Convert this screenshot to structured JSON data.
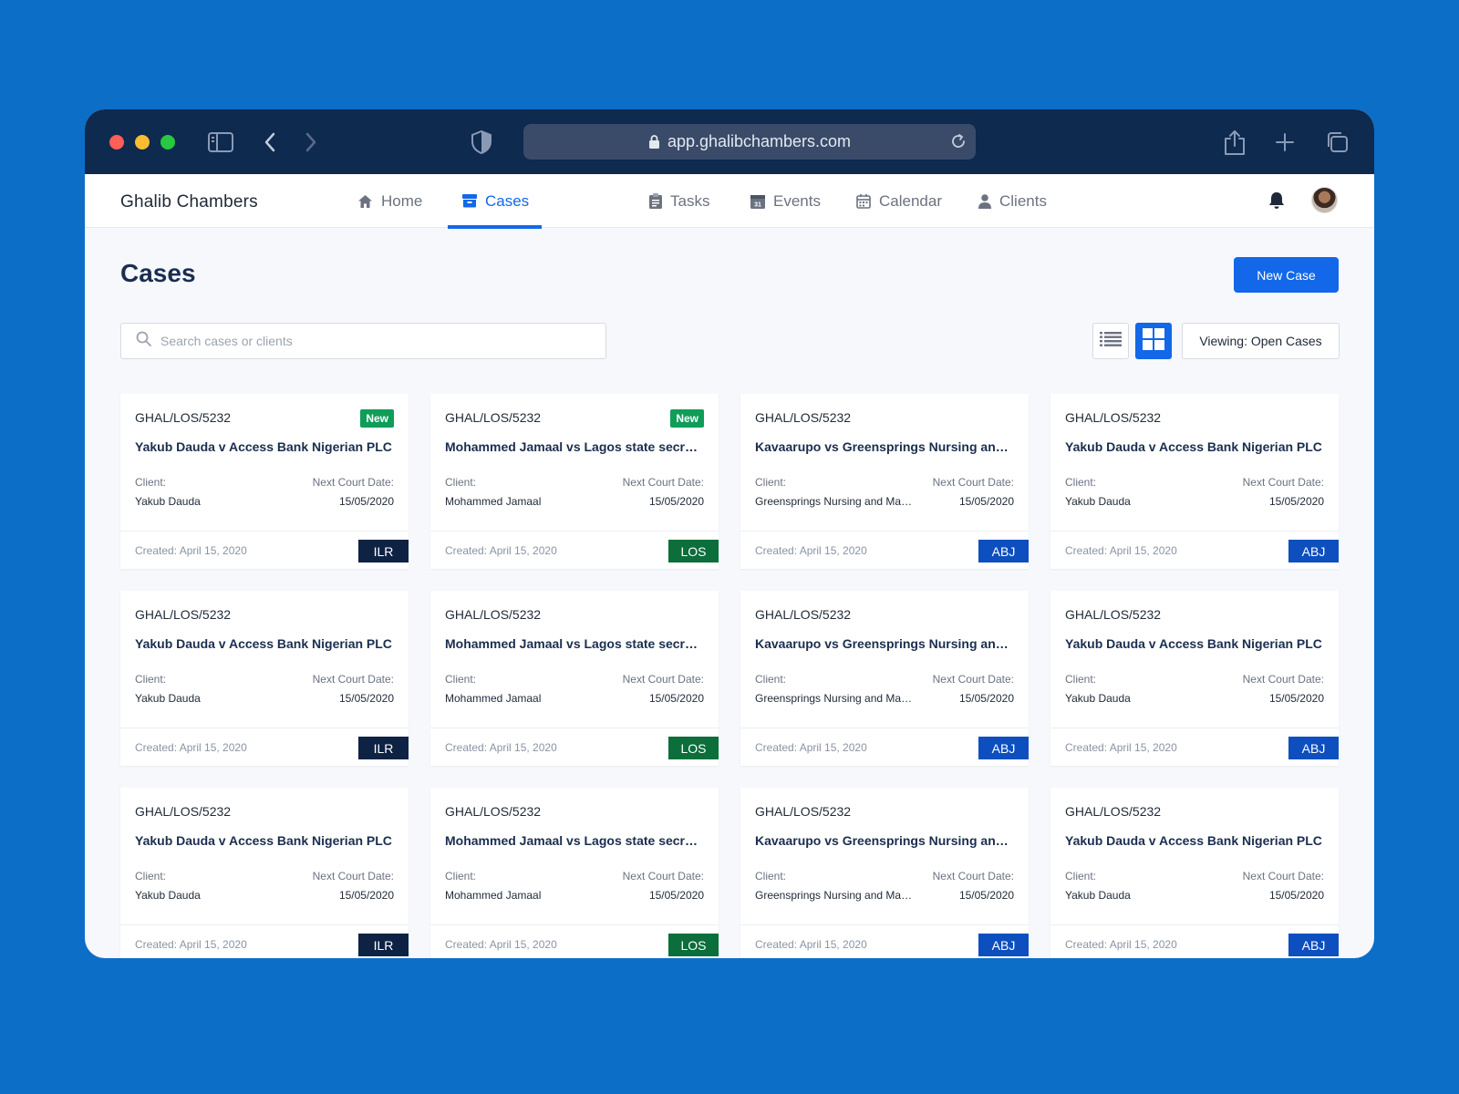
{
  "browser": {
    "url": "app.ghalibchambers.com"
  },
  "app": {
    "brand": "Ghalib Chambers",
    "nav": [
      {
        "label": "Home",
        "icon": "home-icon"
      },
      {
        "label": "Cases",
        "icon": "cases-icon",
        "active": true
      },
      {
        "label": "Tasks",
        "icon": "clipboard-icon"
      },
      {
        "label": "Events",
        "icon": "events-icon"
      },
      {
        "label": "Calendar",
        "icon": "calendar-icon"
      },
      {
        "label": "Clients",
        "icon": "user-icon"
      }
    ]
  },
  "page": {
    "title": "Cases",
    "new_case_label": "New Case",
    "search_placeholder": "Search cases or clients",
    "viewing_label": "Viewing: Open Cases"
  },
  "labels": {
    "client": "Client:",
    "next_court_date": "Next Court Date:",
    "new_badge": "New"
  },
  "colors": {
    "accent": "#1268e8",
    "ILR": "#0e2244",
    "LOS": "#0b6e3b",
    "ABJ": "#0d4fbf",
    "new_badge": "#0f9d58"
  },
  "cases": [
    {
      "ref": "GHAL/LOS/5232",
      "title": "Yakub Dauda v Access Bank Nigerian PLC",
      "client": "Yakub Dauda",
      "next_court_date": "15/05/2020",
      "created": "Created: April 15, 2020",
      "court": "ILR",
      "is_new": true
    },
    {
      "ref": "GHAL/LOS/5232",
      "title": "Mohammed Jamaal vs Lagos state secretariat",
      "client": "Mohammed Jamaal",
      "next_court_date": "15/05/2020",
      "created": "Created: April 15, 2020",
      "court": "LOS",
      "is_new": true
    },
    {
      "ref": "GHAL/LOS/5232",
      "title": "Kavaarupo vs Greensprings Nursing and Maternity",
      "client": "Greensprings Nursing and Maternity",
      "next_court_date": "15/05/2020",
      "created": "Created: April 15, 2020",
      "court": "ABJ",
      "is_new": false
    },
    {
      "ref": "GHAL/LOS/5232",
      "title": "Yakub Dauda v Access Bank Nigerian PLC",
      "client": "Yakub Dauda",
      "next_court_date": "15/05/2020",
      "created": "Created: April 15, 2020",
      "court": "ABJ",
      "is_new": false
    },
    {
      "ref": "GHAL/LOS/5232",
      "title": "Yakub Dauda v Access Bank Nigerian PLC",
      "client": "Yakub Dauda",
      "next_court_date": "15/05/2020",
      "created": "Created: April 15, 2020",
      "court": "ILR",
      "is_new": false
    },
    {
      "ref": "GHAL/LOS/5232",
      "title": "Mohammed Jamaal vs Lagos state secretariat",
      "client": "Mohammed Jamaal",
      "next_court_date": "15/05/2020",
      "created": "Created: April 15, 2020",
      "court": "LOS",
      "is_new": false
    },
    {
      "ref": "GHAL/LOS/5232",
      "title": "Kavaarupo vs Greensprings Nursing and Maternity",
      "client": "Greensprings Nursing and Maternity",
      "next_court_date": "15/05/2020",
      "created": "Created: April 15, 2020",
      "court": "ABJ",
      "is_new": false
    },
    {
      "ref": "GHAL/LOS/5232",
      "title": "Yakub Dauda v Access Bank Nigerian PLC",
      "client": "Yakub Dauda",
      "next_court_date": "15/05/2020",
      "created": "Created: April 15, 2020",
      "court": "ABJ",
      "is_new": false
    },
    {
      "ref": "GHAL/LOS/5232",
      "title": "Yakub Dauda v Access Bank Nigerian PLC",
      "client": "Yakub Dauda",
      "next_court_date": "15/05/2020",
      "created": "Created: April 15, 2020",
      "court": "ILR",
      "is_new": false
    },
    {
      "ref": "GHAL/LOS/5232",
      "title": "Mohammed Jamaal vs Lagos state secretariat",
      "client": "Mohammed Jamaal",
      "next_court_date": "15/05/2020",
      "created": "Created: April 15, 2020",
      "court": "LOS",
      "is_new": false
    },
    {
      "ref": "GHAL/LOS/5232",
      "title": "Kavaarupo vs Greensprings Nursing and Maternity",
      "client": "Greensprings Nursing and Maternity",
      "next_court_date": "15/05/2020",
      "created": "Created: April 15, 2020",
      "court": "ABJ",
      "is_new": false
    },
    {
      "ref": "GHAL/LOS/5232",
      "title": "Yakub Dauda v Access Bank Nigerian PLC",
      "client": "Yakub Dauda",
      "next_court_date": "15/05/2020",
      "created": "Created: April 15, 2020",
      "court": "ABJ",
      "is_new": false
    }
  ]
}
